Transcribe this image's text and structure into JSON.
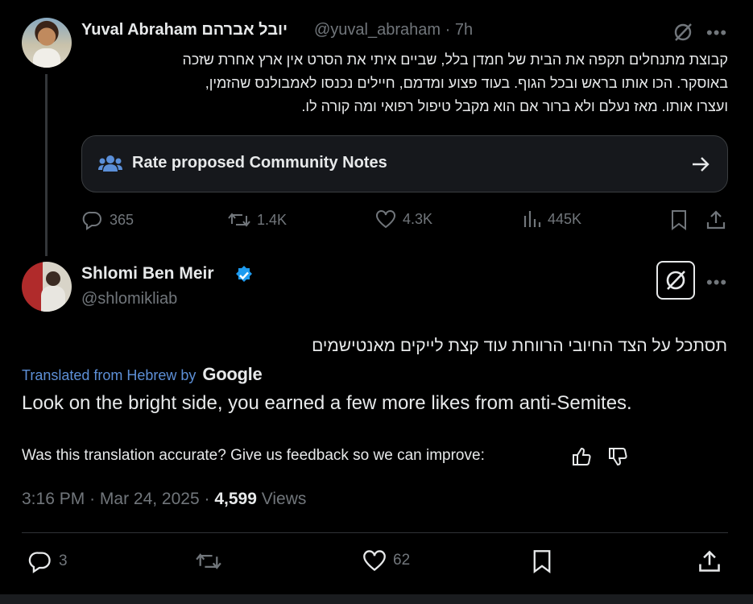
{
  "tweet1": {
    "name": "Yuval Abraham יובל אברהם",
    "handle": "@yuval_abraham",
    "dot": "·",
    "time": "7h",
    "text_lines": [
      "קבוצת מתנחלים תקפה את הבית של חמדן בלל, שביים איתי את הסרט אין ארץ אחרת שזכה",
      "באוסקר. הכו אותו בראש ובכל הגוף. בעוד פצוע ומדמם, חיילים נכנסו לאמבולנס שהזמין,",
      "ועצרו אותו. מאז נעלם ולא ברור אם הוא מקבל טיפול רפואי ומה קורה לו."
    ],
    "community_notes_label": "Rate proposed Community Notes",
    "stats": {
      "replies": "365",
      "reposts": "1.4K",
      "likes": "4.3K",
      "views": "445K"
    }
  },
  "tweet2": {
    "name": "Shlomi Ben Meir",
    "handle": "@shlomikliab",
    "hebrew_text": "תסתכל על הצד החיובי הרווחת עוד קצת לייקים מאנטישמים",
    "translated_label": "Translated from Hebrew by",
    "translator": "Google",
    "translation": "Look on the bright side, you earned a few more likes from anti-Semites.",
    "feedback_prompt": "Was this translation accurate? Give us feedback so we can improve:",
    "time": "3:16 PM",
    "date": "Mar 24, 2025",
    "views_count": "4,599",
    "views_label": "Views",
    "stats": {
      "replies": "3",
      "likes": "62"
    }
  },
  "icons": {
    "more": "more-icon",
    "grok": "grok-icon",
    "community": "community-notes-icon",
    "arrow": "arrow-right-icon",
    "reply": "reply-icon",
    "repost": "repost-icon",
    "like": "like-icon",
    "views": "views-icon",
    "bookmark": "bookmark-icon",
    "share": "share-icon",
    "verified": "verified-badge-icon",
    "thumbs_up": "thumbs-up-icon",
    "thumbs_down": "thumbs-down-icon"
  },
  "colors": {
    "background": "#000000",
    "text": "#e7e9ea",
    "muted": "#71767b",
    "link": "#5d8fd6",
    "verified": "#1d9bf0"
  }
}
